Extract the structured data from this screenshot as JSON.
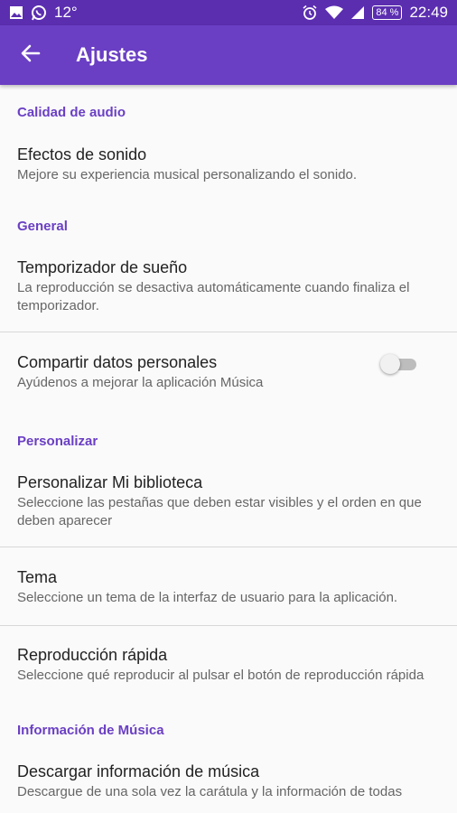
{
  "status_bar": {
    "temperature": "12°",
    "battery": "84 %",
    "time": "22:49",
    "icons": [
      "image-icon",
      "whatsapp-icon",
      "alarm-icon",
      "wifi-icon",
      "signal-icon",
      "battery-icon"
    ]
  },
  "app_bar": {
    "title": "Ajustes",
    "back_icon": "arrow-back-icon",
    "color": "#6a3fc4"
  },
  "sections": {
    "audio": {
      "header": "Calidad de audio",
      "sound_effects": {
        "title": "Efectos de sonido",
        "subtitle": "Mejore su experiencia musical personalizando el sonido."
      }
    },
    "general": {
      "header": "General",
      "sleep_timer": {
        "title": "Temporizador de sueño",
        "subtitle": "La reproducción se desactiva automáticamente cuando finaliza el temporizador."
      },
      "share_data": {
        "title": "Compartir datos personales",
        "subtitle": "Ayúdenos a mejorar la aplicación Música",
        "toggle_on": false
      }
    },
    "personalize": {
      "header": "Personalizar",
      "library": {
        "title": "Personalizar Mi biblioteca",
        "subtitle": "Seleccione las pestañas que deben estar visibles y el orden en que deben aparecer"
      },
      "theme": {
        "title": "Tema",
        "subtitle": "Seleccione un tema de la interfaz de usuario para la aplicación."
      },
      "quick_play": {
        "title": "Reproducción rápida",
        "subtitle": "Seleccione qué reproducir al pulsar el botón de reproducción rápida"
      }
    },
    "music_info": {
      "header": "Información de Música",
      "download_info": {
        "title": "Descargar información de música",
        "subtitle": "Descargue de una sola vez la carátula y la información de todas"
      }
    }
  }
}
